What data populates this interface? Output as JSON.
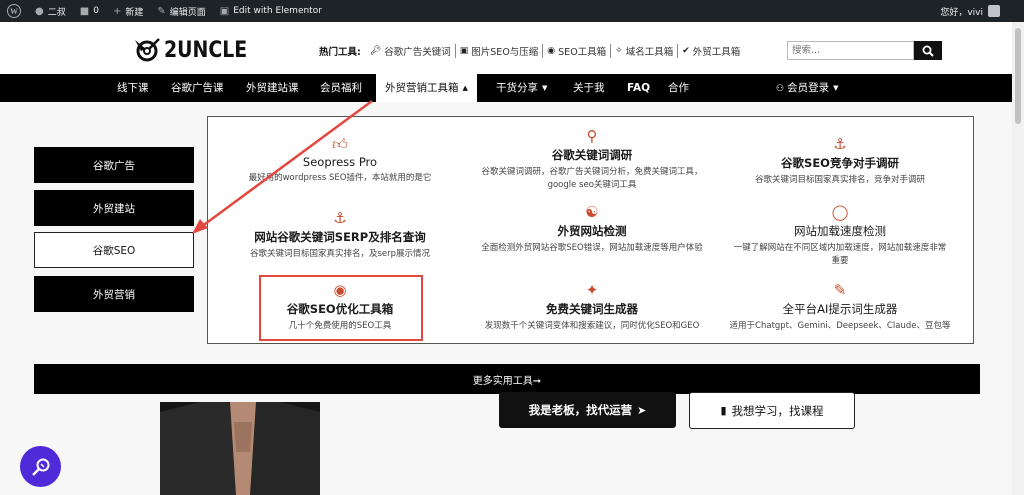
{
  "adminbar": {
    "site": "二叔",
    "comments": "0",
    "new": "新建",
    "edit_page": "编辑页面",
    "elementor": "Edit with Elementor",
    "greeting": "您好，vivi"
  },
  "header": {
    "logo_text": "2UNCLE",
    "hot_label": "热门工具:",
    "hot_items": [
      {
        "icon": "key-icon",
        "label": "谷歌广告关键词"
      },
      {
        "icon": "image-icon",
        "label": "图片SEO与压缩"
      },
      {
        "icon": "seo-icon",
        "label": "SEO工具箱"
      },
      {
        "icon": "domain-icon",
        "label": "域名工具箱"
      },
      {
        "icon": "check-icon",
        "label": "外贸工具箱"
      }
    ],
    "search_placeholder": "搜索..."
  },
  "nav": {
    "items": [
      "线下课",
      "谷歌广告课",
      "外贸建站课",
      "会员福利",
      "外贸营销工具箱",
      "干货分享",
      "关于我",
      "FAQ",
      "合作"
    ],
    "login": "会员登录"
  },
  "side_buttons": [
    "谷歌广告",
    "外贸建站",
    "谷歌SEO",
    "外贸营销"
  ],
  "tools": [
    {
      "icon": "thumbs-up-icon",
      "title": "Seopress Pro",
      "desc": "最好用的wordpress SEO插件，本站就用的是它"
    },
    {
      "icon": "magnifier-icon",
      "title": "谷歌关键词调研",
      "desc": "谷歌关键词调研，谷歌广告关键词分析，免费关键词工具，google seo关键词工具"
    },
    {
      "icon": "anchor-icon",
      "title": "谷歌SEO竞争对手调研",
      "desc": "谷歌关键词目标国家真实排名，竞争对手调研"
    },
    {
      "icon": "anchor-icon",
      "title": "网站谷歌关键词SERP及排名查询",
      "desc": "谷歌关键词目标国家真实排名，及serp展示情况"
    },
    {
      "icon": "user-check-icon",
      "title": "外贸网站检测",
      "desc": "全面检测外贸网站谷歌SEO错误，网站加载速度等用户体验"
    },
    {
      "icon": "lightbulb-icon",
      "title": "网站加载速度检测",
      "desc": "一键了解网站在不同区域内加载速度，网站加载速度非常重要"
    },
    {
      "icon": "eye-icon",
      "title": "谷歌SEO优化工具箱",
      "desc": "几十个免费使用的SEO工具"
    },
    {
      "icon": "magic-wand-icon",
      "title": "免费关键词生成器",
      "desc": "发现数千个关键词变体和搜索建议，同时优化SEO和GEO"
    },
    {
      "icon": "edit-icon",
      "title": "全平台AI提示词生成器",
      "desc": "适用于Chatgpt、Gemini、Deepseek、Claude、豆包等"
    }
  ],
  "more_tools": "更多实用工具➞",
  "cta": {
    "boss": "我是老板，找代运营",
    "learn": "我想学习，找课程"
  },
  "colors": {
    "accent": "#c94c2c",
    "annotation": "#e2483f",
    "fab": "#4f2ad8"
  }
}
